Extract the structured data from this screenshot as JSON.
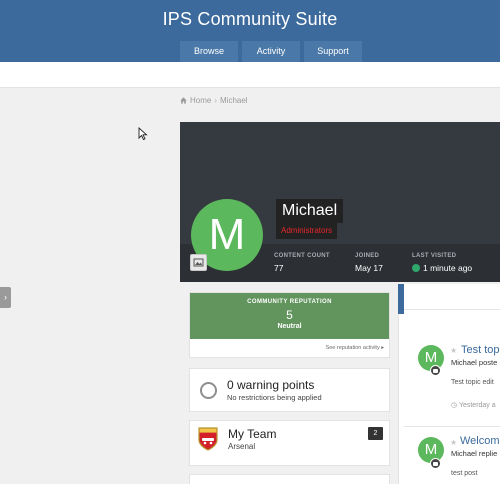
{
  "header": {
    "title": "IPS Community Suite",
    "nav": [
      "Browse",
      "Activity",
      "Support"
    ]
  },
  "breadcrumb": {
    "home": "Home",
    "current": "Michael"
  },
  "profile": {
    "avatar_letter": "M",
    "name": "Michael",
    "group": "Administrators",
    "stats": [
      {
        "label": "CONTENT COUNT",
        "value": "77"
      },
      {
        "label": "JOINED",
        "value": "May 17"
      },
      {
        "label": "LAST VISITED",
        "value": "1 minute ago"
      }
    ]
  },
  "reputation": {
    "title": "COMMUNITY REPUTATION",
    "value": "5",
    "word": "Neutral",
    "link": "See reputation activity"
  },
  "warnings": {
    "title": "0 warning points",
    "subtitle": "No restrictions being applied"
  },
  "team": {
    "title": "My Team",
    "name": "Arsenal",
    "count": "2"
  },
  "activity": [
    {
      "avatar": "M",
      "title": "Test top",
      "meta": "Michael poste",
      "body": "Test topic edit",
      "time": "Yesterday a"
    },
    {
      "avatar": "M",
      "title": "Welcome",
      "meta": "Michael replie",
      "body": "test post"
    }
  ],
  "colors": {
    "header_bg": "#3c6a9c",
    "avatar_green": "#5cb85c",
    "reputation_green": "#62945e",
    "group_red": "#e8262b",
    "online": "#2ea86b"
  },
  "icons": {
    "home": "home-icon",
    "cursor": "mouse-pointer-icon",
    "expand": "chevron-right-icon",
    "cover": "image-icon",
    "online": "online-dot-icon",
    "warning": "warning-circle-icon",
    "crest": "arsenal-crest-icon",
    "star": "star-icon",
    "comment": "comment-icon",
    "clock": "clock-icon"
  }
}
